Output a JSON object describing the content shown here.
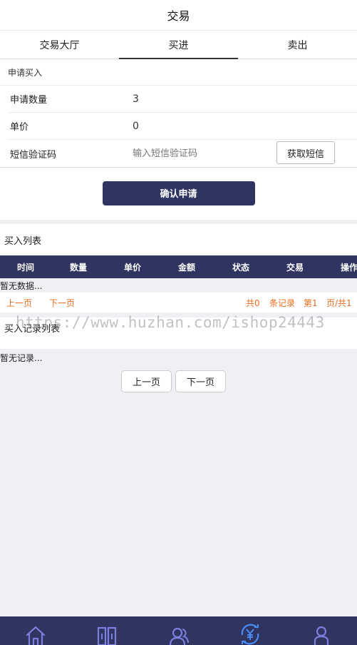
{
  "header": {
    "title": "交易"
  },
  "tabs": [
    {
      "label": "交易大厅",
      "active": false
    },
    {
      "label": "买进",
      "active": true
    },
    {
      "label": "卖出",
      "active": false
    }
  ],
  "form": {
    "section_title": "申请买入",
    "quantity_label": "申请数量",
    "quantity_value": "3",
    "price_label": "单价",
    "price_value": "0",
    "sms_label": "短信验证码",
    "sms_placeholder": "输入短信验证码",
    "sms_button": "获取短信",
    "confirm_button": "确认申请"
  },
  "buy_list": {
    "title": "买入列表",
    "columns": [
      "时间",
      "数量",
      "单价",
      "金额",
      "状态",
      "交易",
      "操作"
    ],
    "empty_text": "暂无数据...",
    "pager": {
      "prev": "上一页",
      "next": "下一页",
      "total": "共0",
      "unit": "条记录",
      "page": "第1",
      "pages": "页/共1"
    }
  },
  "records": {
    "title": "买入记录列表",
    "empty_text": "暂无记录...",
    "prev": "上一页",
    "next": "下一页"
  },
  "watermark": "https://www.huzhan.com/ishop24443",
  "bottom_nav": {
    "icons": [
      "home-icon",
      "book-icon",
      "users-icon",
      "yuan-exchange-icon",
      "user-icon"
    ],
    "color": "#7b7fe0",
    "active_color": "#4a8cf5",
    "bg": "#2f3461"
  }
}
